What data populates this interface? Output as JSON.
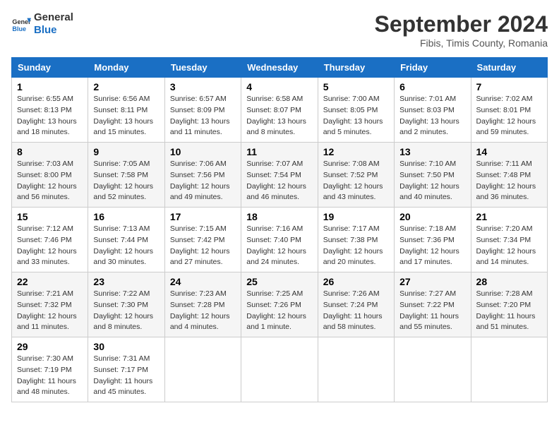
{
  "header": {
    "logo_line1": "General",
    "logo_line2": "Blue",
    "month": "September 2024",
    "location": "Fibis, Timis County, Romania"
  },
  "columns": [
    "Sunday",
    "Monday",
    "Tuesday",
    "Wednesday",
    "Thursday",
    "Friday",
    "Saturday"
  ],
  "weeks": [
    [
      {
        "day": "1",
        "info": "Sunrise: 6:55 AM\nSunset: 8:13 PM\nDaylight: 13 hours\nand 18 minutes."
      },
      {
        "day": "2",
        "info": "Sunrise: 6:56 AM\nSunset: 8:11 PM\nDaylight: 13 hours\nand 15 minutes."
      },
      {
        "day": "3",
        "info": "Sunrise: 6:57 AM\nSunset: 8:09 PM\nDaylight: 13 hours\nand 11 minutes."
      },
      {
        "day": "4",
        "info": "Sunrise: 6:58 AM\nSunset: 8:07 PM\nDaylight: 13 hours\nand 8 minutes."
      },
      {
        "day": "5",
        "info": "Sunrise: 7:00 AM\nSunset: 8:05 PM\nDaylight: 13 hours\nand 5 minutes."
      },
      {
        "day": "6",
        "info": "Sunrise: 7:01 AM\nSunset: 8:03 PM\nDaylight: 13 hours\nand 2 minutes."
      },
      {
        "day": "7",
        "info": "Sunrise: 7:02 AM\nSunset: 8:01 PM\nDaylight: 12 hours\nand 59 minutes."
      }
    ],
    [
      {
        "day": "8",
        "info": "Sunrise: 7:03 AM\nSunset: 8:00 PM\nDaylight: 12 hours\nand 56 minutes."
      },
      {
        "day": "9",
        "info": "Sunrise: 7:05 AM\nSunset: 7:58 PM\nDaylight: 12 hours\nand 52 minutes."
      },
      {
        "day": "10",
        "info": "Sunrise: 7:06 AM\nSunset: 7:56 PM\nDaylight: 12 hours\nand 49 minutes."
      },
      {
        "day": "11",
        "info": "Sunrise: 7:07 AM\nSunset: 7:54 PM\nDaylight: 12 hours\nand 46 minutes."
      },
      {
        "day": "12",
        "info": "Sunrise: 7:08 AM\nSunset: 7:52 PM\nDaylight: 12 hours\nand 43 minutes."
      },
      {
        "day": "13",
        "info": "Sunrise: 7:10 AM\nSunset: 7:50 PM\nDaylight: 12 hours\nand 40 minutes."
      },
      {
        "day": "14",
        "info": "Sunrise: 7:11 AM\nSunset: 7:48 PM\nDaylight: 12 hours\nand 36 minutes."
      }
    ],
    [
      {
        "day": "15",
        "info": "Sunrise: 7:12 AM\nSunset: 7:46 PM\nDaylight: 12 hours\nand 33 minutes."
      },
      {
        "day": "16",
        "info": "Sunrise: 7:13 AM\nSunset: 7:44 PM\nDaylight: 12 hours\nand 30 minutes."
      },
      {
        "day": "17",
        "info": "Sunrise: 7:15 AM\nSunset: 7:42 PM\nDaylight: 12 hours\nand 27 minutes."
      },
      {
        "day": "18",
        "info": "Sunrise: 7:16 AM\nSunset: 7:40 PM\nDaylight: 12 hours\nand 24 minutes."
      },
      {
        "day": "19",
        "info": "Sunrise: 7:17 AM\nSunset: 7:38 PM\nDaylight: 12 hours\nand 20 minutes."
      },
      {
        "day": "20",
        "info": "Sunrise: 7:18 AM\nSunset: 7:36 PM\nDaylight: 12 hours\nand 17 minutes."
      },
      {
        "day": "21",
        "info": "Sunrise: 7:20 AM\nSunset: 7:34 PM\nDaylight: 12 hours\nand 14 minutes."
      }
    ],
    [
      {
        "day": "22",
        "info": "Sunrise: 7:21 AM\nSunset: 7:32 PM\nDaylight: 12 hours\nand 11 minutes."
      },
      {
        "day": "23",
        "info": "Sunrise: 7:22 AM\nSunset: 7:30 PM\nDaylight: 12 hours\nand 8 minutes."
      },
      {
        "day": "24",
        "info": "Sunrise: 7:23 AM\nSunset: 7:28 PM\nDaylight: 12 hours\nand 4 minutes."
      },
      {
        "day": "25",
        "info": "Sunrise: 7:25 AM\nSunset: 7:26 PM\nDaylight: 12 hours\nand 1 minute."
      },
      {
        "day": "26",
        "info": "Sunrise: 7:26 AM\nSunset: 7:24 PM\nDaylight: 11 hours\nand 58 minutes."
      },
      {
        "day": "27",
        "info": "Sunrise: 7:27 AM\nSunset: 7:22 PM\nDaylight: 11 hours\nand 55 minutes."
      },
      {
        "day": "28",
        "info": "Sunrise: 7:28 AM\nSunset: 7:20 PM\nDaylight: 11 hours\nand 51 minutes."
      }
    ],
    [
      {
        "day": "29",
        "info": "Sunrise: 7:30 AM\nSunset: 7:19 PM\nDaylight: 11 hours\nand 48 minutes."
      },
      {
        "day": "30",
        "info": "Sunrise: 7:31 AM\nSunset: 7:17 PM\nDaylight: 11 hours\nand 45 minutes."
      },
      null,
      null,
      null,
      null,
      null
    ]
  ]
}
